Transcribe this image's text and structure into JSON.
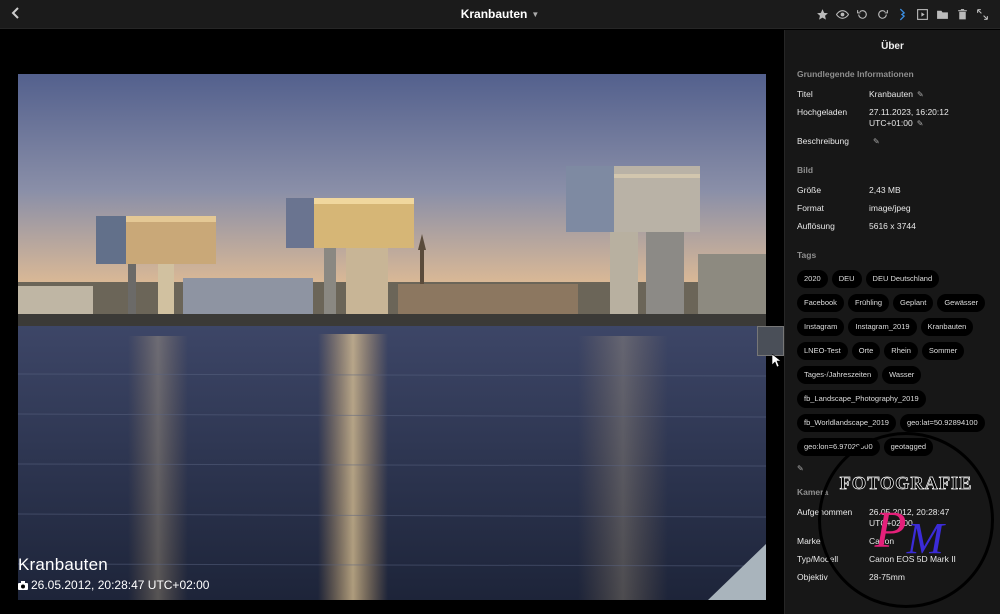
{
  "header": {
    "title": "Kranbauten",
    "toolbar_icons": [
      "star-icon",
      "eye-icon",
      "rotate-left-icon",
      "rotate-right-icon",
      "share-icon",
      "slideshow-icon",
      "folder-icon",
      "trash-icon",
      "fullscreen-icon"
    ]
  },
  "photo": {
    "title": "Kranbauten",
    "date": "26.05.2012, 20:28:47 UTC+02:00",
    "camera_icon": "camera-icon"
  },
  "sidebar": {
    "title": "Über",
    "basic": {
      "heading": "Grundlegende Informationen",
      "title_label": "Titel",
      "title_value": "Kranbauten",
      "uploaded_label": "Hochgeladen",
      "uploaded_value_1": "27.11.2023, 16:20:12",
      "uploaded_value_2": "UTC+01:00",
      "desc_label": "Beschreibung"
    },
    "image": {
      "heading": "Bild",
      "size_label": "Größe",
      "size_value": "2,43 MB",
      "format_label": "Format",
      "format_value": "image/jpeg",
      "res_label": "Auflösung",
      "res_value": "5616 x 3744"
    },
    "tags": {
      "heading": "Tags",
      "items": [
        "2020",
        "DEU",
        "DEU Deutschland",
        "Facebook",
        "Frühling",
        "Geplant",
        "Gewässer",
        "Instagram",
        "Instagram_2019",
        "Kranbauten",
        "LNEO-Test",
        "Orte",
        "Rhein",
        "Sommer",
        "Tages-/Jahreszeiten",
        "Wasser",
        "fb_Landscape_Photography_2019",
        "fb_Worldlandscape_2019",
        "geo:lat=50.92894100",
        "geo:lon=6.97029000",
        "geotagged"
      ]
    },
    "camera": {
      "heading": "Kamera",
      "taken_label": "Aufgenommen",
      "taken_value_1": "26.05.2012, 20:28:47",
      "taken_value_2": "UTC+02:00",
      "make_label": "Marke",
      "make_value": "Canon",
      "model_label": "Typ/Modell",
      "model_value": "Canon EOS 5D Mark II",
      "lens_label": "Objektiv",
      "lens_value": "28-75mm"
    }
  },
  "watermark": {
    "text": "FOTOGRAFIE",
    "initials": "PM"
  }
}
